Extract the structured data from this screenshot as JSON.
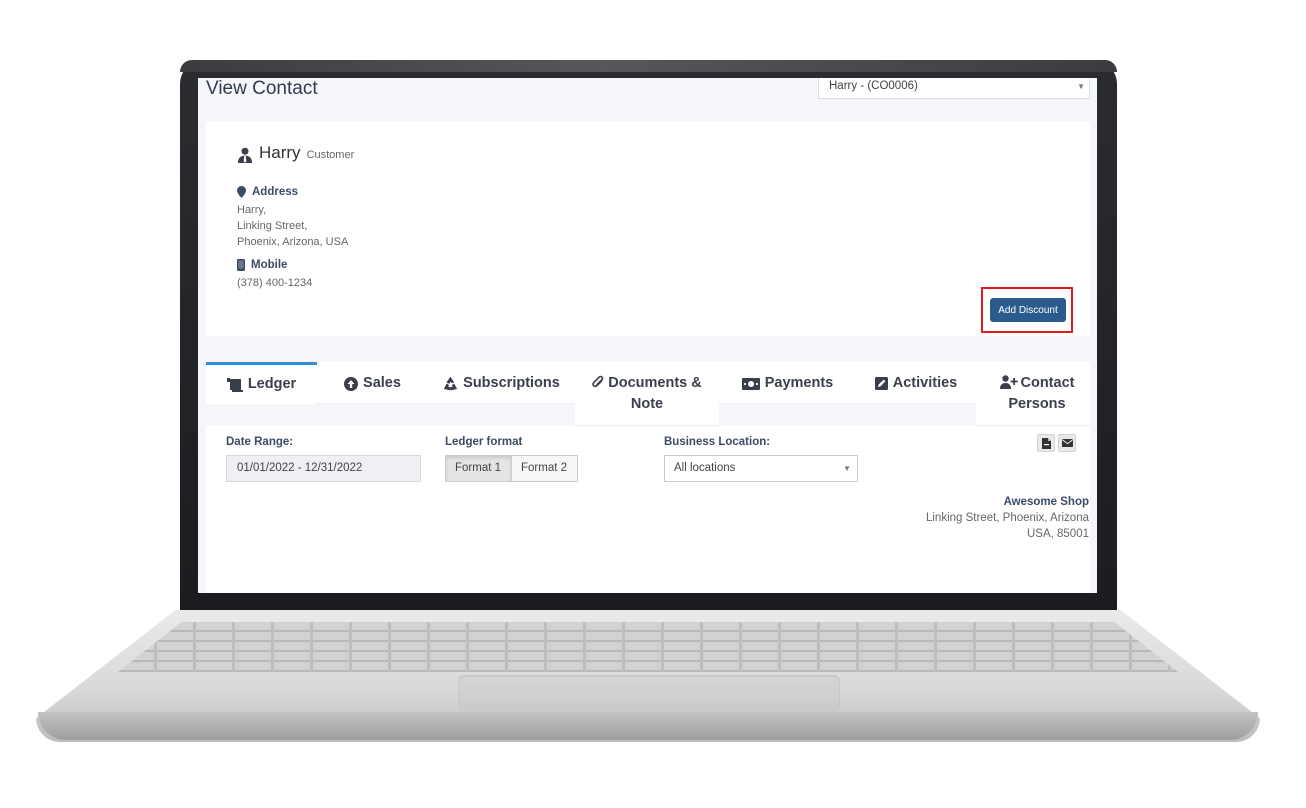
{
  "page": {
    "title": "View Contact"
  },
  "contact_select": {
    "value": "Harry - (CO0006)"
  },
  "contact": {
    "name": "Harry",
    "type": "Customer",
    "address_label": "Address",
    "address_lines": [
      "Harry,",
      "Linking Street,",
      "Phoenix, Arizona, USA"
    ],
    "mobile_label": "Mobile",
    "mobile": "(378) 400-1234"
  },
  "actions": {
    "add_discount": "Add Discount"
  },
  "tabs": [
    {
      "label": "Ledger",
      "icon": "ledger-icon",
      "active": true
    },
    {
      "label": "Sales",
      "icon": "arrow-circle-up-icon",
      "active": false
    },
    {
      "label": "Subscriptions",
      "icon": "recycle-icon",
      "active": false
    },
    {
      "label": "Documents & Note",
      "icon": "paperclip-icon",
      "active": false
    },
    {
      "label": "Payments",
      "icon": "money-icon",
      "active": false
    },
    {
      "label": "Activities",
      "icon": "edit-icon",
      "active": false
    },
    {
      "label": "Contact Persons",
      "icon": "user-plus-icon",
      "active": false
    }
  ],
  "ledger": {
    "date_range_label": "Date Range:",
    "date_range_value": "01/01/2022 - 12/31/2022",
    "format_label": "Ledger format",
    "formats": [
      "Format 1",
      "Format 2"
    ],
    "selected_format": "Format 1",
    "location_label": "Business Location:",
    "location_value": "All locations"
  },
  "shop": {
    "name": "Awesome Shop",
    "address_line1": "Linking Street, Phoenix, Arizona",
    "address_line2": "USA, 85001"
  },
  "colors": {
    "primary_button": "#2b5b8c",
    "active_tab_border": "#2f8fd8",
    "highlight_frame": "#e01b1b",
    "label_text": "#3c4b66"
  }
}
